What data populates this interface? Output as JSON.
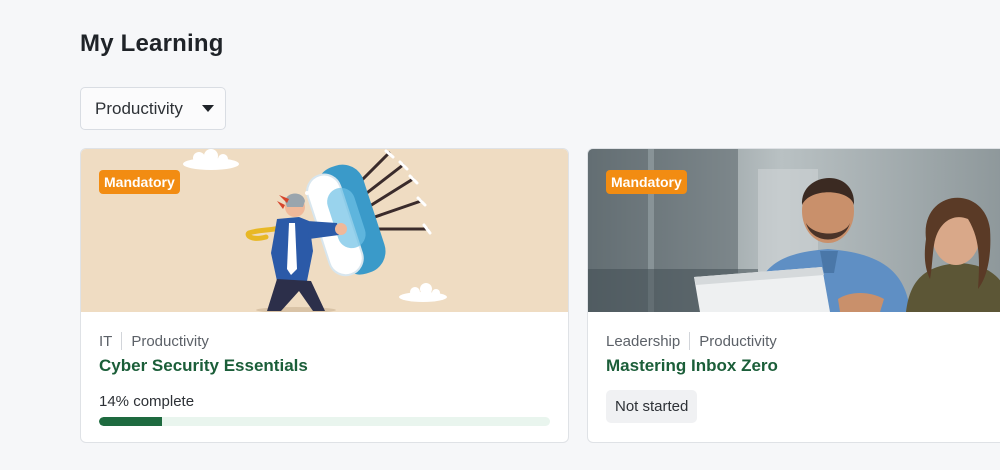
{
  "page": {
    "title": "My Learning"
  },
  "filter": {
    "selected": "Productivity",
    "caret_icon": "caret-down-icon"
  },
  "courses": [
    {
      "badge": "Mandatory",
      "categories": [
        "IT",
        "Productivity"
      ],
      "title": "Cyber Security Essentials",
      "progress_text": "14% complete",
      "progress_percent": 14,
      "image": "illustration-shield-arrows",
      "image_bg": "#efdcc2"
    },
    {
      "badge": "Mandatory",
      "categories": [
        "Leadership",
        "Productivity"
      ],
      "title": "Mastering Inbox Zero",
      "status": "Not started",
      "image": "photo-colleagues-laptop",
      "image_bg": "#a9b2b6"
    }
  ],
  "colors": {
    "badge": "#f28c12",
    "title_green": "#1b5e39",
    "progress_fill": "#1e6a3f",
    "progress_track": "#e9f5ee",
    "background": "#f6f7f9"
  }
}
